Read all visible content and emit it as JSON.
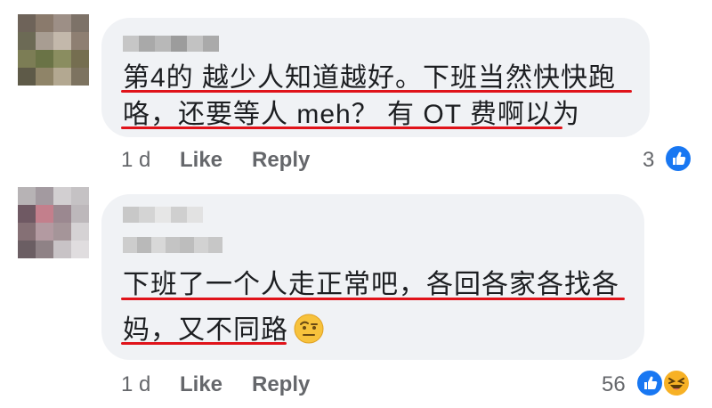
{
  "comments": [
    {
      "lines": [
        "第4的 越少人知道越好。下班当然快快跑",
        "咯，还要等人 meh？ 有 OT 费啊以为"
      ],
      "time": "1 d",
      "like_label": "Like",
      "reply_label": "Reply",
      "reaction_count": "3",
      "reactions": [
        "like-icon"
      ]
    },
    {
      "lines": [
        "下班了一个人走正常吧，各回各家各找各",
        "妈，又不同路"
      ],
      "emoji": "raised-eyebrow-emoji",
      "time": "1 d",
      "like_label": "Like",
      "reply_label": "Reply",
      "reaction_count": "56",
      "reactions": [
        "like-icon",
        "haha-icon"
      ]
    }
  ],
  "colors": {
    "bubble": "#f0f2f5",
    "underline": "#e0131a",
    "meta_text": "#65676b",
    "like_blue": "#1877f2",
    "haha_yellow": "#f7b125"
  }
}
